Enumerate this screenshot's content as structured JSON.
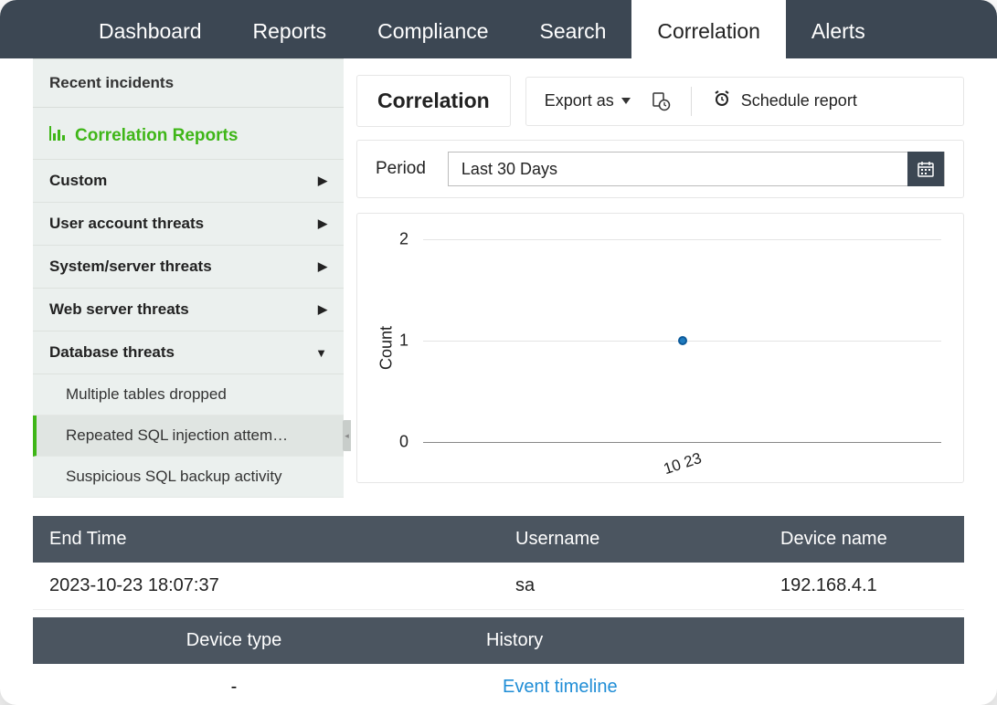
{
  "nav": {
    "tabs": [
      "Dashboard",
      "Reports",
      "Compliance",
      "Search",
      "Correlation",
      "Alerts"
    ],
    "active": "Correlation"
  },
  "sidebar": {
    "header": "Recent incidents",
    "section_title": "Correlation Reports",
    "items": [
      {
        "label": "Custom",
        "expanded": false
      },
      {
        "label": "User account threats",
        "expanded": false
      },
      {
        "label": "System/server threats",
        "expanded": false
      },
      {
        "label": "Web server threats",
        "expanded": false
      },
      {
        "label": "Database threats",
        "expanded": true
      }
    ],
    "subitems": [
      {
        "label": "Multiple tables dropped",
        "active": false
      },
      {
        "label": "Repeated SQL injection attem…",
        "active": true
      },
      {
        "label": "Suspicious SQL backup activity",
        "active": false
      }
    ]
  },
  "content": {
    "title": "Correlation",
    "export_label": "Export as",
    "schedule_label": "Schedule report",
    "period_label": "Period",
    "period_value": "Last 30 Days"
  },
  "chart_data": {
    "type": "scatter",
    "title": "",
    "xlabel": "",
    "ylabel": "Count",
    "ylim": [
      0,
      2
    ],
    "yticks": [
      0,
      1,
      2
    ],
    "x_categories": [
      "10 23"
    ],
    "series": [
      {
        "name": "events",
        "values": [
          {
            "x": "10 23",
            "y": 1
          }
        ]
      }
    ]
  },
  "table": {
    "columns": [
      "End Time",
      "Username",
      "Device name"
    ],
    "rows": [
      {
        "end_time": "2023-10-23 18:07:37",
        "username": "sa",
        "device_name": "192.168.4.1"
      }
    ],
    "columns2": [
      "Device type",
      "History"
    ],
    "rows2": [
      {
        "device_type": "-",
        "history": "Event timeline"
      }
    ]
  }
}
